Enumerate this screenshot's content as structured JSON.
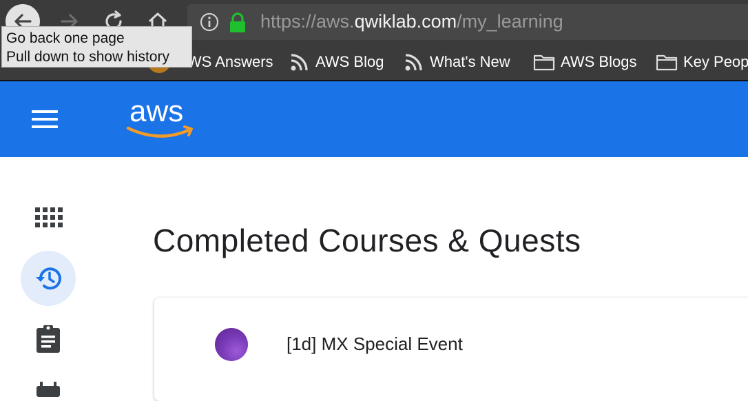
{
  "browser": {
    "url_prefix": "https://aws.",
    "url_domain": "qwiklab.com",
    "url_path": "/my_learning",
    "tooltip_line1": "Go back one page",
    "tooltip_line2": "Pull down to show history"
  },
  "bookmarks": [
    {
      "label": "AWS Answers",
      "icon": "image-icon"
    },
    {
      "label": "AWS Blog",
      "icon": "rss-icon"
    },
    {
      "label": "What's New",
      "icon": "rss-icon"
    },
    {
      "label": "AWS Blogs",
      "icon": "folder-icon"
    },
    {
      "label": "Key People",
      "icon": "folder-icon"
    }
  ],
  "header": {
    "logo_text": "aws",
    "brand_color": "#1b73e8",
    "accent_color": "#f29b29"
  },
  "sidebar": {
    "items": [
      {
        "icon": "grid-icon"
      },
      {
        "icon": "history-icon",
        "active": true
      },
      {
        "icon": "clipboard-icon"
      },
      {
        "icon": "calendar-icon"
      }
    ]
  },
  "main": {
    "title": "Completed Courses & Quests",
    "cards": [
      {
        "title": "[1d] MX Special Event"
      }
    ]
  }
}
